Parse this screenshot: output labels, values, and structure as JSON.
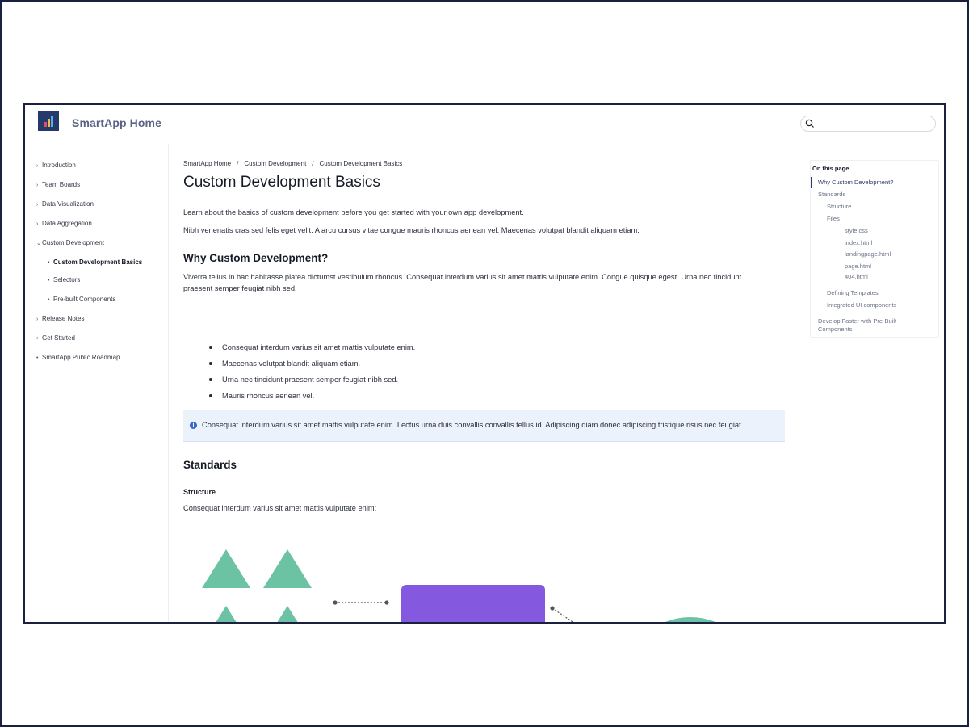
{
  "header": {
    "title": "SmartApp Home",
    "search_placeholder": ""
  },
  "sidebar": {
    "items": [
      {
        "label": "Introduction",
        "marker": "›"
      },
      {
        "label": "Team Boards",
        "marker": "›"
      },
      {
        "label": "Data Visualization",
        "marker": "›"
      },
      {
        "label": "Data Aggregation",
        "marker": "›"
      },
      {
        "label": "Custom Development",
        "marker": "⌄"
      },
      {
        "label": "Custom Development Basics",
        "marker": "•"
      },
      {
        "label": "Selectors",
        "marker": "•"
      },
      {
        "label": "Pre-built Components",
        "marker": "•"
      },
      {
        "label": "Release Notes",
        "marker": "›"
      },
      {
        "label": "Get Started",
        "marker": "•"
      },
      {
        "label": "SmartApp Public Roadmap",
        "marker": "•"
      }
    ]
  },
  "breadcrumb": [
    "SmartApp Home",
    "Custom Development",
    "Custom Development Basics"
  ],
  "breadcrumb_sep": "/",
  "main": {
    "title": "Custom Development Basics",
    "intro_1": "Learn about the basics of custom development before you get started with your own app development.",
    "intro_2": "Nibh venenatis cras sed felis eget velit. A arcu cursus vitae congue mauris rhoncus aenean vel. Maecenas volutpat blandit aliquam etiam.",
    "why_heading": "Why Custom Development?",
    "why_para_1": "Viverra tellus in hac habitasse platea dictumst vestibulum rhoncus. Consequat interdum varius sit amet mattis vulputate enim. Congue quisque egest. Urna nec tincidunt",
    "why_para_2": "praesent semper feugiat nibh sed.",
    "bullets": [
      "Consequat interdum varius sit amet mattis vulputate enim.",
      "Maecenas volutpat blandit aliquam etiam.",
      "Urna nec tincidunt praesent semper feugiat nibh sed.",
      "Mauris rhoncus aenean vel."
    ],
    "note": "Consequat interdum varius sit amet mattis vulputate enim. Lectus urna duis convallis convallis tellus id. Adipiscing diam donec adipiscing tristique risus nec feugiat.",
    "note_icon": "i",
    "standards_heading": "Standards",
    "structure_heading": "Structure",
    "structure_para": "Consequat interdum varius sit amet mattis vulputate enim:"
  },
  "toc": {
    "title": "On this page",
    "items": [
      "Why Custom Development?",
      "Standards",
      "Structure",
      "Files",
      "style.css",
      "index.html",
      "landingpage.html",
      "page.html",
      "404.html",
      "Defining Templates",
      "Integrated UI components",
      "Develop Faster with Pre-Built",
      "Components"
    ]
  },
  "colors": {
    "accent": "#2d3b66",
    "note_bg": "#ecf2fc",
    "illustration_green": "#6cc3a3",
    "illustration_purple": "#8558e0"
  }
}
